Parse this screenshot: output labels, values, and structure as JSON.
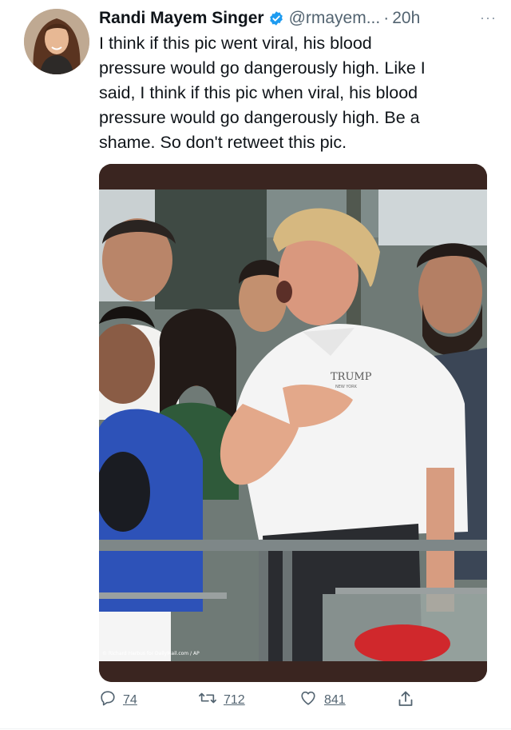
{
  "tweet": {
    "author_name": "Randi Mayem Singer",
    "handle": "@rmayem...",
    "separator": "·",
    "time": "20h",
    "more_label": "···",
    "text": "I think if this pic went viral, his blood\npressure would go dangerously high. Like I\nsaid, I think if this pic when viral, his blood\npressure would go dangerously high. Be a\nshame. So don't retweet this pic.",
    "photo_credit": "© Richard Harbus for DailyMail.com / AP",
    "shirt_logo": "TRUMP",
    "shirt_logo_sub": "NEW YORK"
  },
  "actions": {
    "reply_count": "74",
    "retweet_count": "712",
    "like_count": "841"
  },
  "colors": {
    "verified_blue": "#1d9bf0",
    "secondary_text": "#536471",
    "primary_text": "#0f1419"
  },
  "icons": [
    "verified-badge-icon",
    "more-icon",
    "reply-icon",
    "retweet-icon",
    "like-icon",
    "share-icon"
  ]
}
